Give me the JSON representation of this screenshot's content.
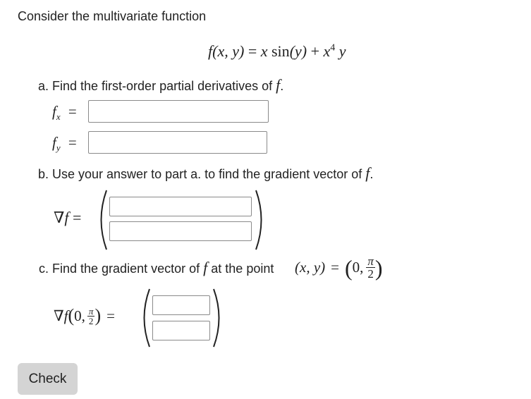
{
  "intro": "Consider the multivariate function",
  "function_def": {
    "f": "f",
    "args": "(x, y)",
    "eq": "=",
    "x": "x",
    "sin": "sin",
    "sin_arg": "(y)",
    "plus": "+",
    "x2": "x",
    "exp": "4",
    "y": "y"
  },
  "part_a": {
    "text": "a. Find the first-order partial derivatives of",
    "var": "f",
    "period": ".",
    "fx_label": "f",
    "fx_sub": "x",
    "fy_label": "f",
    "fy_sub": "y",
    "eq": "="
  },
  "part_b": {
    "text": "b. Use your answer to part a. to find the gradient vector of",
    "var": "f",
    "period": ".",
    "grad_label": "∇f",
    "eq": "="
  },
  "part_c": {
    "text_before": "c. Find the gradient vector of",
    "var": "f",
    "text_mid": "at the point",
    "point_lhs": "(x, y)",
    "eq": "=",
    "point_x": "0,",
    "pi": "π",
    "two": "2",
    "grad_label": "∇f",
    "eval_x": "0,",
    "eval_pi": "π",
    "eval_two": "2",
    "eq2": "="
  },
  "check_button": "Check"
}
